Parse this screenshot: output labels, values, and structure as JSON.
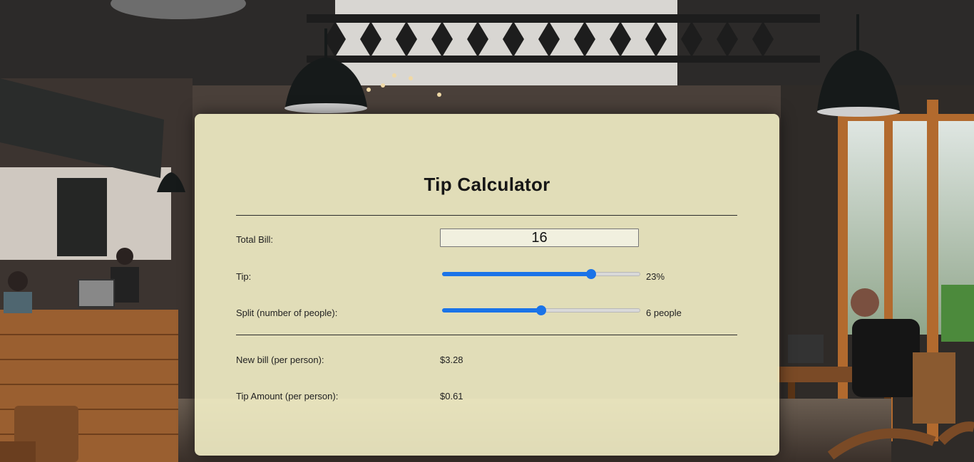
{
  "app": {
    "title": "Tip Calculator"
  },
  "form": {
    "total_bill": {
      "label": "Total Bill:",
      "value": "16"
    },
    "tip": {
      "label": "Tip:",
      "percent": 23,
      "min": 0,
      "max": 30,
      "display": "23%"
    },
    "split": {
      "label": "Split (number of people):",
      "people": 6,
      "min": 1,
      "max": 11,
      "display": "6 people"
    }
  },
  "results": {
    "new_bill": {
      "label": "New bill (per person):",
      "value": "$3.28"
    },
    "tip_amount": {
      "label": "Tip Amount (per person):",
      "value": "$0.61"
    }
  },
  "colors": {
    "card": "#faf7cd",
    "accent": "#1a73e8",
    "text": "#222222"
  }
}
